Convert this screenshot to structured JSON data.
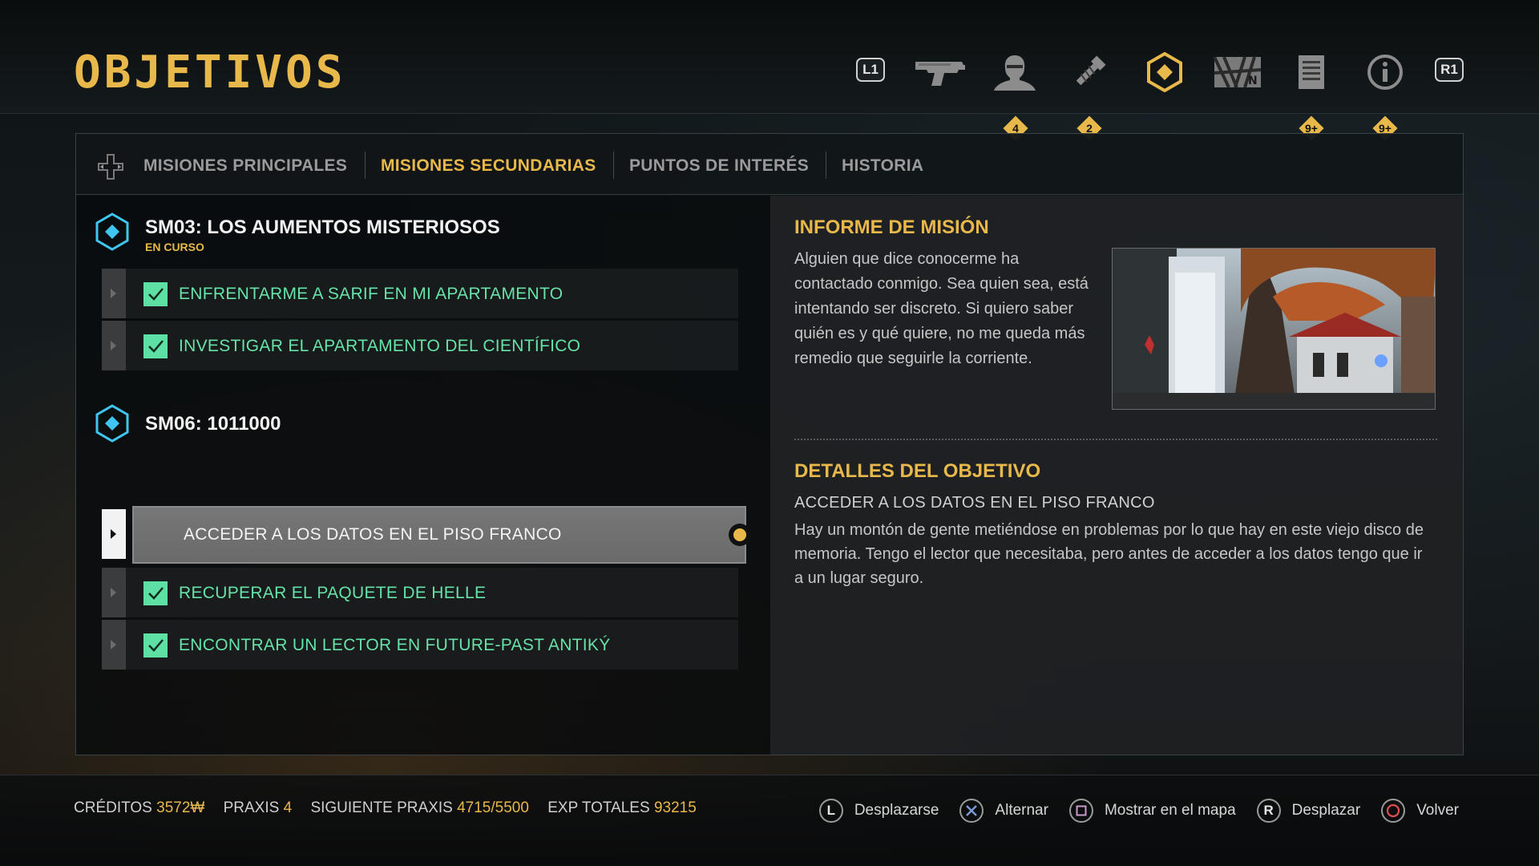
{
  "header": {
    "title": "OBJETIVOS",
    "left_bumper": "L1",
    "right_bumper": "R1",
    "nav_icons": [
      {
        "name": "weapons",
        "icon": "pistol-icon"
      },
      {
        "name": "augmentations",
        "icon": "head-silhouette-icon",
        "badge": "4"
      },
      {
        "name": "crafting",
        "icon": "screw-icon",
        "badge": "2"
      },
      {
        "name": "objectives",
        "icon": "diamond-objective-icon",
        "active": true
      },
      {
        "name": "map",
        "icon": "map-icon"
      },
      {
        "name": "database",
        "icon": "document-icon",
        "badge": "9+"
      },
      {
        "name": "info",
        "icon": "info-icon",
        "badge": "9+"
      }
    ]
  },
  "tabs": {
    "items": [
      {
        "label": "MISIONES PRINCIPALES",
        "active": false
      },
      {
        "label": "MISIONES SECUNDARIAS",
        "active": true
      },
      {
        "label": "PUNTOS DE INTERÉS",
        "active": false
      },
      {
        "label": "HISTORIA",
        "active": false
      }
    ]
  },
  "missions": [
    {
      "title": "SM03: LOS AUMENTOS MISTERIOSOS",
      "status": "EN CURSO",
      "objectives": [
        {
          "label": "ENFRENTARME A SARIF EN MI APARTAMENTO",
          "completed": true
        },
        {
          "label": "INVESTIGAR EL APARTAMENTO DEL CIENTÍFICO",
          "completed": true
        }
      ]
    },
    {
      "title": "SM06: 1011000",
      "status": "",
      "objectives": [
        {
          "label": "ACCEDER A LOS DATOS EN EL PISO FRANCO",
          "completed": false,
          "selected": true,
          "tracked": true
        },
        {
          "label": "RECUPERAR EL PAQUETE DE HELLE",
          "completed": true
        },
        {
          "label": "ENCONTRAR UN LECTOR EN FUTURE-PAST ANTIKÝ",
          "completed": true
        }
      ]
    }
  ],
  "briefing": {
    "heading": "INFORME DE MISIÓN",
    "text": "Alguien que dice conocerme ha contactado conmigo. Sea quien sea, está intentando ser discreto. Si quiero saber quién es y qué quiere, no me queda más remedio que seguirle la corriente."
  },
  "objective_details": {
    "heading": "DETALLES DEL OBJETIVO",
    "name": "ACCEDER A LOS DATOS EN EL PISO FRANCO",
    "description": "Hay un montón de gente metiéndose en problemas por lo que hay en este viejo disco de memoria. Tengo el lector que necesitaba, pero antes de acceder a los datos tengo que ir a un lugar seguro."
  },
  "footer": {
    "stats": [
      {
        "label": "CRÉDITOS",
        "value": "3572₩"
      },
      {
        "label": "PRAXIS",
        "value": "4"
      },
      {
        "label": "SIGUIENTE PRAXIS",
        "value": "4715/5500"
      },
      {
        "label": "EXP TOTALES",
        "value": "93215"
      }
    ],
    "prompts": [
      {
        "button": "L",
        "label": "Desplazarse"
      },
      {
        "button": "cross",
        "label": "Alternar"
      },
      {
        "button": "square",
        "label": "Mostrar en el mapa"
      },
      {
        "button": "R",
        "label": "Desplazar"
      },
      {
        "button": "circle",
        "label": "Volver"
      }
    ]
  },
  "colors": {
    "accent": "#e8b94a",
    "completed": "#66e3a8",
    "mission_icon": "#3fc6f0",
    "cross": "#7a9ad8",
    "square": "#c79ac8",
    "circle": "#e05050"
  }
}
